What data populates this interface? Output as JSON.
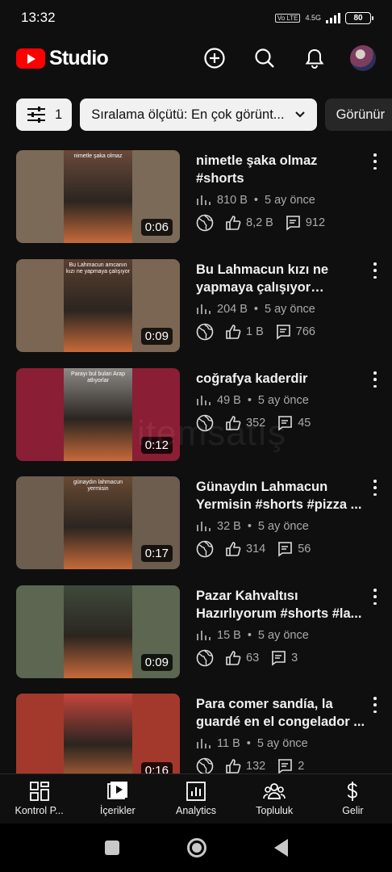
{
  "status_bar": {
    "time": "13:32",
    "volte": "Vo LTE",
    "network": "4.5G",
    "battery": "80"
  },
  "app": {
    "logo_text": "Studio"
  },
  "toolbar": {
    "icons": [
      "add-circle-icon",
      "search-icon",
      "bell-icon",
      "avatar"
    ]
  },
  "filters": {
    "filter_count": "1",
    "sort_label": "Sıralama ölçütü: En çok görünt...",
    "visibility_label": "Görünür"
  },
  "videos": [
    {
      "title": "nimetle şaka olmaz #shorts",
      "duration": "0:06",
      "views": "810 B",
      "age": "5 ay önce",
      "likes": "8,2 B",
      "comments": "912",
      "thumb_caption": "nimetle şaka olmaz",
      "thumb_bg": "#7b6a58",
      "thumb_portrait": "#6b4a3a"
    },
    {
      "title": "Bu Lahmacun kızı ne yapmaya çalışıyor #short...",
      "duration": "0:09",
      "views": "204 B",
      "age": "5 ay önce",
      "likes": "1 B",
      "comments": "766",
      "thumb_caption": "Bu Lahmacun amcanın kızı ne yapmaya çalışıyor",
      "thumb_bg": "#7a6652",
      "thumb_portrait": "#5a3f2f"
    },
    {
      "title": "coğrafya kaderdir",
      "duration": "0:12",
      "views": "49 B",
      "age": "5 ay önce",
      "likes": "352",
      "comments": "45",
      "thumb_caption": "Parayı bul bulan Arap atlıyorlar",
      "thumb_bg": "#8a1e34",
      "thumb_portrait": "#8d8a86"
    },
    {
      "title": "Günaydın Lahmacun Yermisin #shorts #pizza ...",
      "duration": "0:17",
      "views": "32 B",
      "age": "5 ay önce",
      "likes": "314",
      "comments": "56",
      "thumb_caption": "günaydın lahmacun yermisin",
      "thumb_bg": "#6c5d4e",
      "thumb_portrait": "#6a4a34"
    },
    {
      "title": "Pazar Kahvaltısı Hazırlıyorum #shorts #la...",
      "duration": "0:09",
      "views": "15 B",
      "age": "5 ay önce",
      "likes": "63",
      "comments": "3",
      "thumb_caption": "",
      "thumb_bg": "#5c6650",
      "thumb_portrait": "#3f4a3a"
    },
    {
      "title": "Para comer sandía, la guardé en el congelador ...",
      "duration": "0:16",
      "views": "11 B",
      "age": "5 ay önce",
      "likes": "132",
      "comments": "2",
      "thumb_caption": "",
      "thumb_bg": "#a3392c",
      "thumb_portrait": "#c4453c"
    }
  ],
  "bottom_nav": [
    {
      "label": "Kontrol P...",
      "icon": "dashboard-icon"
    },
    {
      "label": "İçerikler",
      "icon": "content-icon"
    },
    {
      "label": "Analytics",
      "icon": "analytics-icon"
    },
    {
      "label": "Topluluk",
      "icon": "community-icon"
    },
    {
      "label": "Gelir",
      "icon": "dollar-icon"
    }
  ],
  "watermark": "itemsatış"
}
